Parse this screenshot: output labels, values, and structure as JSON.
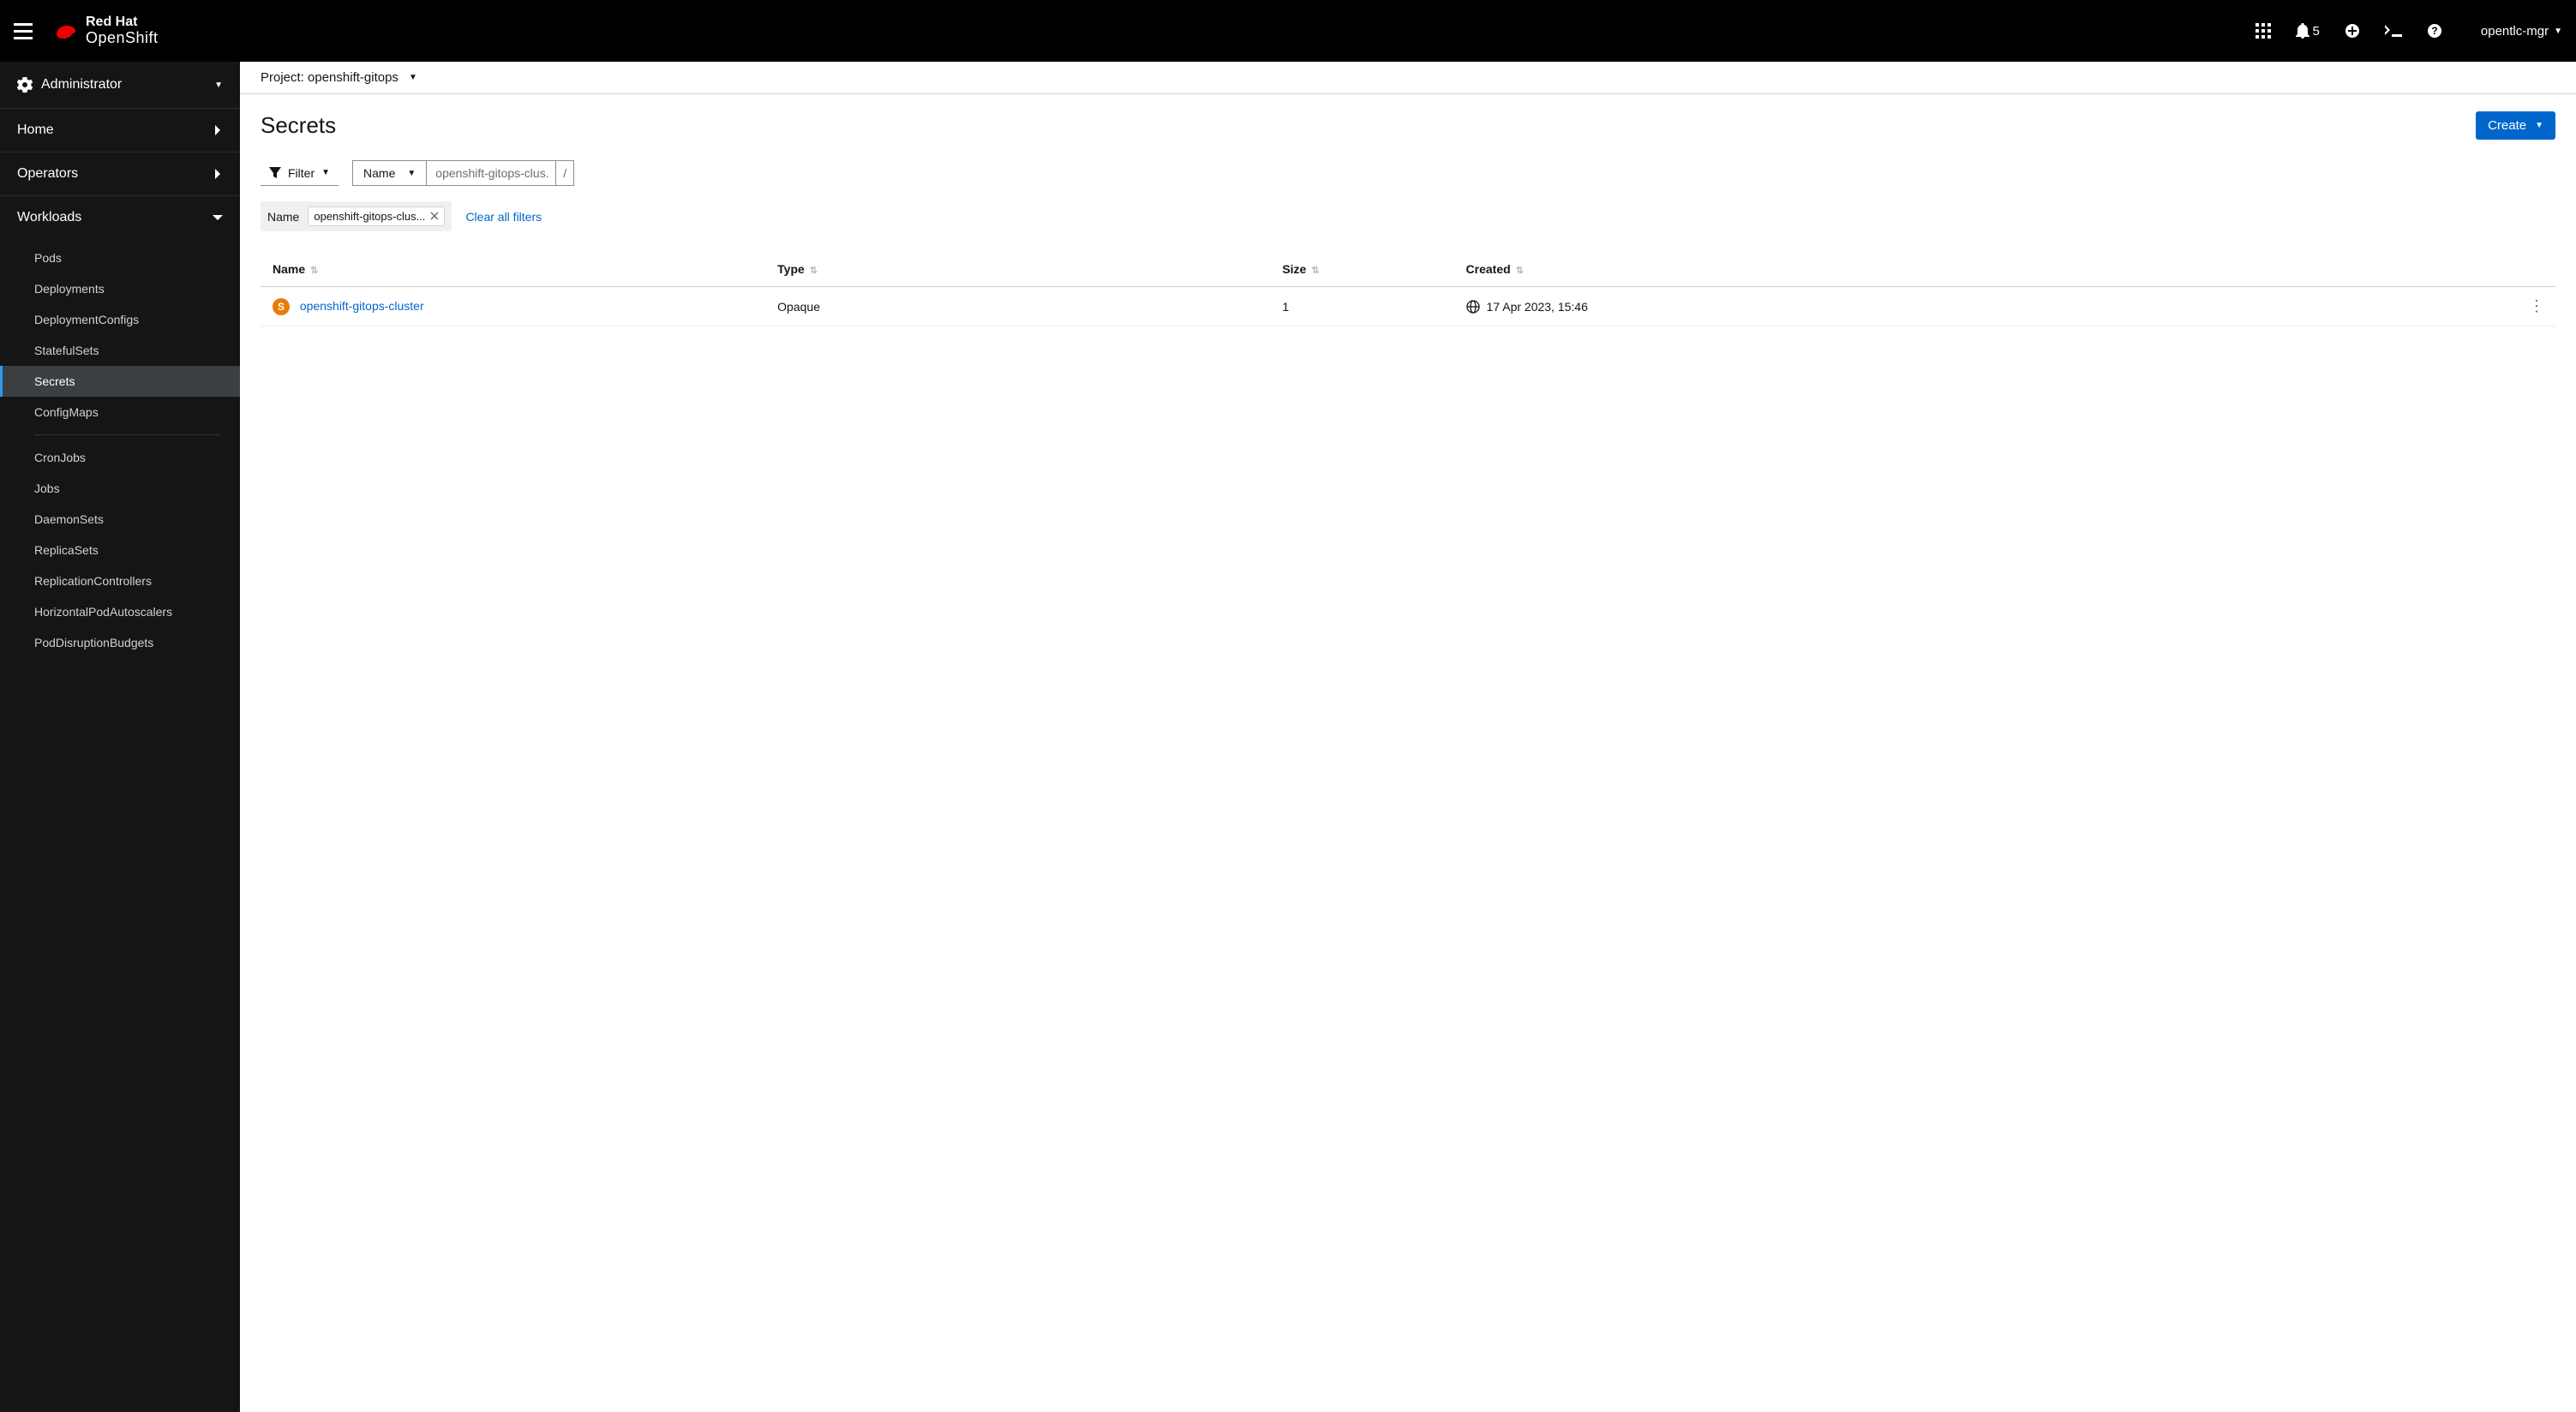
{
  "masthead": {
    "brand_top": "Red Hat",
    "brand_bottom": "OpenShift",
    "notification_count": "5",
    "user": "opentlc-mgr"
  },
  "sidebar": {
    "perspective": "Administrator",
    "sections": [
      {
        "label": "Home",
        "expanded": false
      },
      {
        "label": "Operators",
        "expanded": false
      },
      {
        "label": "Workloads",
        "expanded": true
      }
    ],
    "workload_items": [
      "Pods",
      "Deployments",
      "DeploymentConfigs",
      "StatefulSets",
      "Secrets",
      "ConfigMaps",
      "CronJobs",
      "Jobs",
      "DaemonSets",
      "ReplicaSets",
      "ReplicationControllers",
      "HorizontalPodAutoscalers",
      "PodDisruptionBudgets"
    ],
    "active_item": "Secrets"
  },
  "project": {
    "label_prefix": "Project: ",
    "name": "openshift-gitops"
  },
  "page_title": "Secrets",
  "create_btn": "Create",
  "toolbar": {
    "filter_label": "Filter",
    "name_dd_label": "Name",
    "search_value": "openshift-gitops-clus...",
    "slash": "/"
  },
  "chips": {
    "group_label": "Name",
    "chip_text": "openshift-gitops-clus...",
    "clear_label": "Clear all filters"
  },
  "table": {
    "headers": [
      "Name",
      "Type",
      "Size",
      "Created"
    ],
    "rows": [
      {
        "badge": "S",
        "name": "openshift-gitops-cluster",
        "type": "Opaque",
        "size": "1",
        "created": "17 Apr 2023, 15:46"
      }
    ]
  }
}
